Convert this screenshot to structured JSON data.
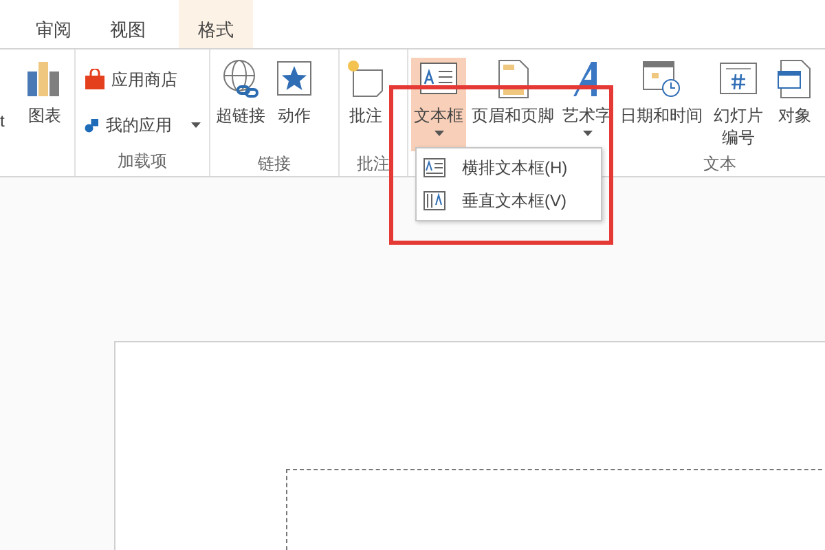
{
  "tabs": [
    {
      "label": "审阅",
      "selected": false
    },
    {
      "label": "视图",
      "selected": false
    },
    {
      "label": "格式",
      "selected": true
    }
  ],
  "ribbon_groups": [
    {
      "items": [
        {
          "kind": "cut",
          "label": "t"
        },
        {
          "kind": "large",
          "label": "图表",
          "pressed": false,
          "dropdown": false
        }
      ]
    },
    {
      "label": "加载项",
      "items": [
        {
          "kind": "small",
          "label": "应用商店",
          "dropdown": false
        },
        {
          "kind": "small",
          "label": "我的应用",
          "dropdown": true
        }
      ]
    },
    {
      "label": "链接",
      "items": [
        {
          "kind": "large",
          "label": "超链接",
          "pressed": false,
          "dropdown": false
        },
        {
          "kind": "large",
          "label": "动作",
          "pressed": false,
          "dropdown": false
        }
      ]
    },
    {
      "label": "批注",
      "items": [
        {
          "kind": "large",
          "label": "批注",
          "pressed": false,
          "dropdown": false
        }
      ]
    },
    {
      "label": "文本",
      "items": [
        {
          "kind": "large",
          "label": "文本框",
          "pressed": true,
          "dropdown": true
        },
        {
          "kind": "large",
          "label": "页眉和页脚",
          "pressed": false,
          "dropdown": false
        },
        {
          "kind": "large",
          "label": "艺术字",
          "pressed": false,
          "dropdown": true
        },
        {
          "kind": "large",
          "label": "日期和时间",
          "pressed": false,
          "dropdown": false
        },
        {
          "kind": "large",
          "label": "幻灯片编号",
          "pressed": false,
          "dropdown": false
        },
        {
          "kind": "large",
          "label": "对象",
          "pressed": false,
          "dropdown": false
        }
      ]
    }
  ],
  "menu": {
    "items": [
      {
        "label": "横排文本框(H)"
      },
      {
        "label": "垂直文本框(V)"
      }
    ]
  }
}
